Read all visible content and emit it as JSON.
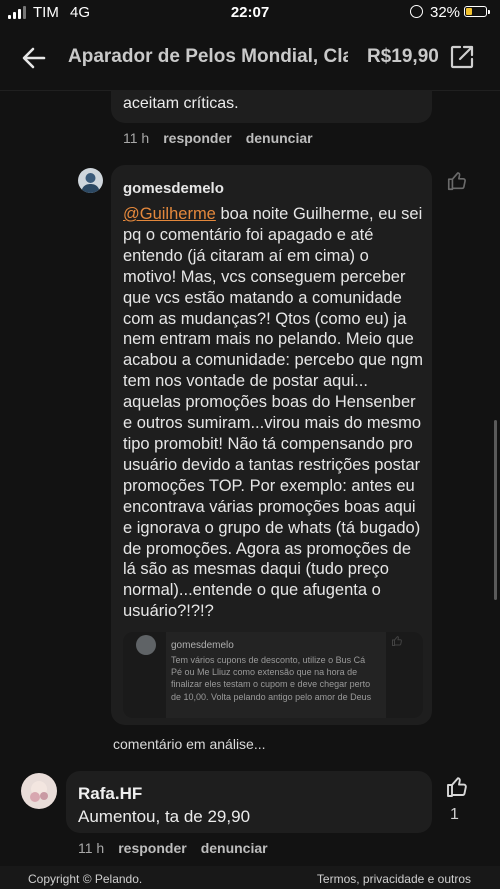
{
  "status_bar": {
    "carrier": "TIM",
    "network": "4G",
    "time": "22:07",
    "battery_percent": "32%",
    "battery_level": 0.32,
    "battery_color": "#f2c230"
  },
  "header": {
    "back_icon": "arrow-left-icon",
    "title": "Aparador de Pelos Mondial, Cla",
    "price": "R$19,90",
    "external_icon": "external-link-icon"
  },
  "previous_comment": {
    "text_tail": "aceitam críticas.",
    "time": "11 h",
    "reply_label": "responder",
    "report_label": "denunciar"
  },
  "comment": {
    "username": "gomesdemelo",
    "mention": "@Guilherme",
    "text": "boa noite Guilherme, eu sei pq o comentário foi apagado e até entendo (já citaram aí em cima) o motivo! Mas, vcs conseguem perceber que vcs estão matando a comunidade com as mudanças?! Qtos (como eu) ja nem entram mais no pelando. Meio que acabou a comunidade: percebo que ngm tem nos vontade de postar aqui... aquelas promoções boas do Hensenber e outros sumiram...virou mais do mesmo tipo promobit! Não tá compensando pro usuário devido a tantas restrições postar promoções TOP. Por exemplo: antes eu encontrava várias promoções boas aqui e ignorava o grupo de whats (tá bugado) de promoções. Agora as promoções de lá são as mesmas daqui (tudo preço normal)...entende o que afugenta o usuário?!?!?",
    "like_icon": "thumbs-up-icon",
    "quoted": {
      "username": "gomesdemelo",
      "text": "Tem vários cupons de desconto, utilize o Bus Cá Pé ou Me Lliuz como extensão que na hora de finalizar eles testam o cupom e deve chegar perto de 10,00. Volta pelando antigo pelo amor de Deus"
    },
    "status": "comentário em análise..."
  },
  "reply": {
    "username": "Rafa.HF",
    "text": "Aumentou, ta de 29,90",
    "time": "11 h",
    "reply_label": "responder",
    "report_label": "denunciar",
    "like_icon": "thumbs-up-icon",
    "like_count": "1"
  },
  "footer": {
    "copyright": "Copyright © Pelando.",
    "terms": "Termos, privacidade e outros"
  }
}
